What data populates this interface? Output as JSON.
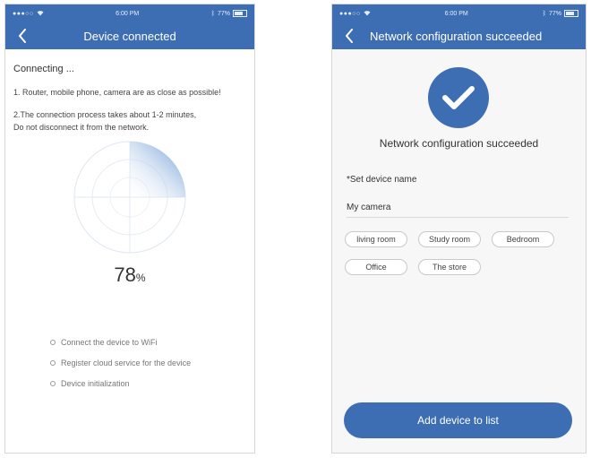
{
  "status_bar": {
    "signal": "●●●○○",
    "time": "6:00 PM",
    "battery": "77%"
  },
  "left_screen": {
    "title": "Device connected",
    "back_icon": "chevron-left-icon",
    "connecting_text": "Connecting ...",
    "note1": "1. Router, mobile phone, camera are as close as possible!",
    "note2": "2.The connection process takes about 1-2 minutes,",
    "note3": "Do not disconnect it from the network.",
    "progress_percent": 78,
    "progress_value": "78",
    "progress_unit": "%",
    "steps": [
      {
        "label": "Connect the device to WiFi"
      },
      {
        "label": "Register cloud service for the device"
      },
      {
        "label": "Device initialization"
      }
    ]
  },
  "right_screen": {
    "title": "Network configuration succeeded",
    "back_icon": "chevron-left-icon",
    "success_icon": "checkmark-icon",
    "success_text": "Network configuration succeeded",
    "name_label": "*Set device name",
    "name_value": "My camera",
    "name_chips": [
      "living room",
      "Study room",
      "Bedroom",
      "Office",
      "The store"
    ],
    "add_button": "Add device to list"
  },
  "colors": {
    "primary": "#3d6eb4",
    "radar_fill": "#5b8fd0"
  }
}
